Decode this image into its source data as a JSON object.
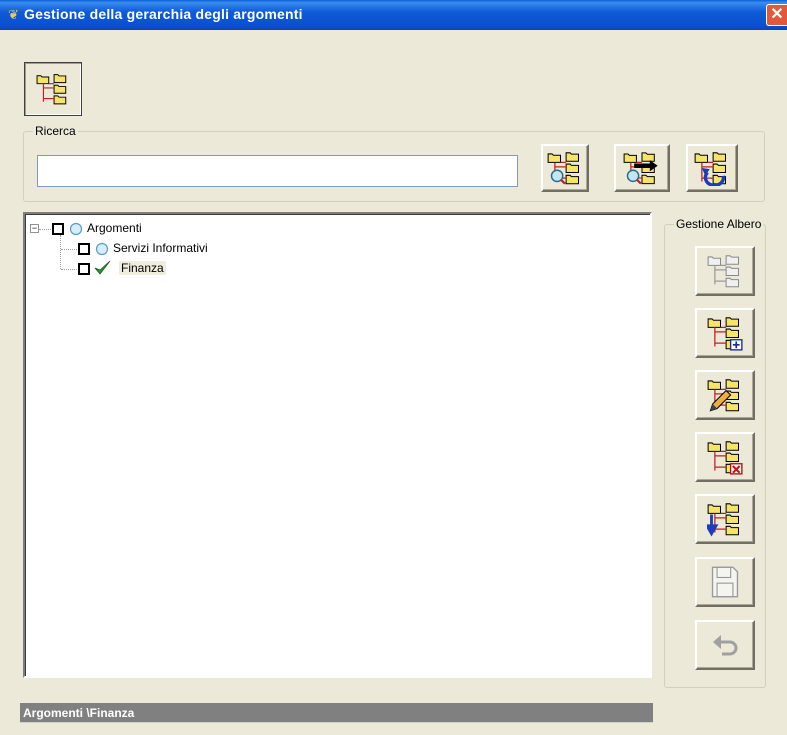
{
  "window": {
    "title": "Gestione della gerarchia degli argomenti",
    "close_glyph": "✕",
    "icon": "app-icon"
  },
  "toolbar": {
    "main_button_icon": "hierarchy-tree-icon"
  },
  "search": {
    "group_label": "Ricerca",
    "value": "",
    "buttons": [
      {
        "name": "search-tree-button",
        "icon": "tree-search-icon"
      },
      {
        "name": "search-next-button",
        "icon": "tree-search-next-icon"
      },
      {
        "name": "search-reset-button",
        "icon": "tree-refresh-icon"
      }
    ]
  },
  "tree": {
    "root": {
      "label": "Argomenti",
      "expander": "−",
      "state_icon": "circle-icon"
    },
    "children": [
      {
        "label": "Servizi Informativi",
        "state_icon": "circle-icon",
        "selected": false
      },
      {
        "label": "Finanza",
        "state_icon": "checkmark-icon",
        "selected": true
      }
    ]
  },
  "tree_management": {
    "group_label": "Gestione Albero",
    "buttons": [
      {
        "name": "expand-all-button",
        "icon": "tree-expand-icon",
        "enabled": false
      },
      {
        "name": "add-node-button",
        "icon": "tree-add-icon",
        "enabled": true
      },
      {
        "name": "edit-node-button",
        "icon": "tree-edit-icon",
        "enabled": true
      },
      {
        "name": "delete-node-button",
        "icon": "tree-delete-icon",
        "enabled": true
      },
      {
        "name": "move-node-button",
        "icon": "tree-move-icon",
        "enabled": true
      },
      {
        "name": "save-button",
        "icon": "floppy-disk-icon",
        "enabled": false
      },
      {
        "name": "undo-button",
        "icon": "undo-icon",
        "enabled": false
      }
    ]
  },
  "status": {
    "path": "Argomenti \\Finanza"
  },
  "colors": {
    "title_bar": "#0a54d0",
    "window_bg": "#ece9d8",
    "folder_yellow": "#f6e46a",
    "status_bg": "#808080"
  }
}
